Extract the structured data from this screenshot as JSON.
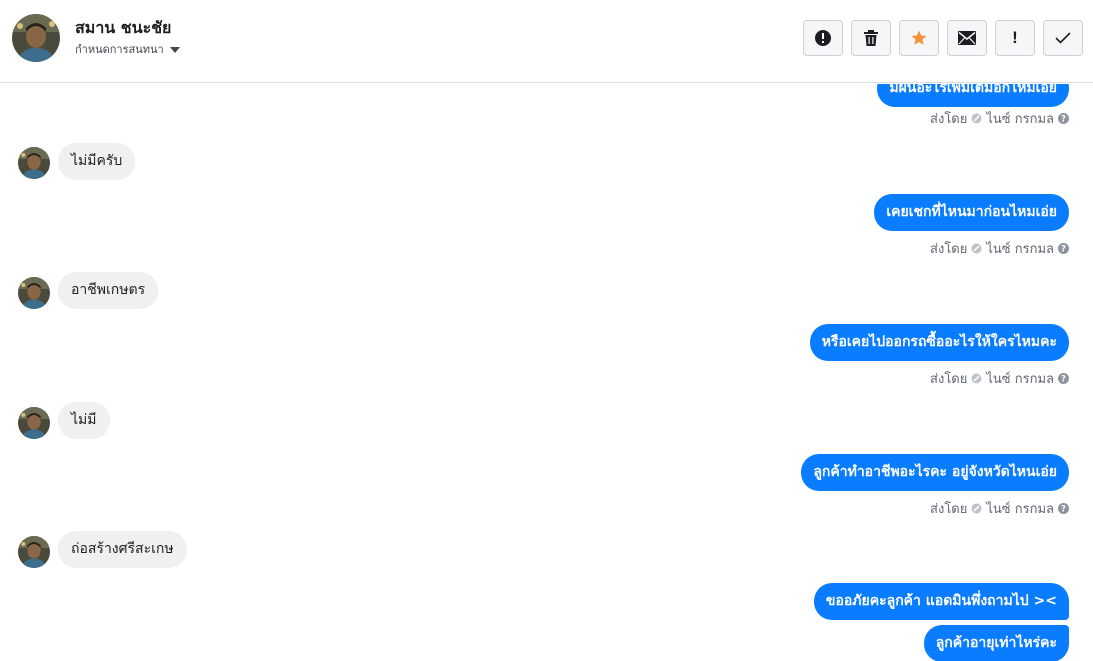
{
  "header": {
    "name": "สมาน ชนะชัย",
    "subtitle": "กำหนดการสนทนา",
    "avatar_icon": "profile-photo"
  },
  "toolbar": {
    "buttons": [
      {
        "name": "spam-button",
        "icon": "exclamation-circle-icon"
      },
      {
        "name": "delete-button",
        "icon": "trash-icon"
      },
      {
        "name": "star-button",
        "icon": "star-icon",
        "color": "#f7923b"
      },
      {
        "name": "mail-button",
        "icon": "envelope-icon"
      },
      {
        "name": "important-button",
        "label": "!"
      },
      {
        "name": "done-button",
        "icon": "checkmark-icon"
      }
    ]
  },
  "thread": {
    "messages": [
      {
        "dir": "out",
        "text": "มีผีนอะไรเพิ่มเติมอีกไหมเอ่ย",
        "meta": {
          "sent_by": "ส่งโดย",
          "agent": "ไนซ์ กรกมล"
        }
      },
      {
        "dir": "in",
        "text": "ไม่มีครับ"
      },
      {
        "dir": "out",
        "text": "เคยเชกที่ไหนมาก่อนไหมเอ่ย",
        "meta": {
          "sent_by": "ส่งโดย",
          "agent": "ไนซ์ กรกมล"
        }
      },
      {
        "dir": "in",
        "text": "อาชีพเกษตร"
      },
      {
        "dir": "out",
        "text": "หรือเคยไปออกรถซื้ออะไรให้ใครไหมคะ",
        "meta": {
          "sent_by": "ส่งโดย",
          "agent": "ไนซ์ กรกมล"
        }
      },
      {
        "dir": "in",
        "text": "ไม่มี"
      },
      {
        "dir": "out",
        "text": "ลูกค้าทำอาชีพอะไรคะ อยู่จังหวัดไหนเอ่ย",
        "meta": {
          "sent_by": "ส่งโดย",
          "agent": "ไนซ์ กรกมล"
        }
      },
      {
        "dir": "in",
        "text": "ถ่อสร้างศรีสะเกษ"
      },
      {
        "dir": "out",
        "text": "ขออภัยคะลูกค้า แอดมินพึ่งถามไป ><"
      },
      {
        "dir": "out",
        "text": "ลูกค้าอายุเท่าไหร่คะ"
      }
    ]
  },
  "colors": {
    "outgoing_bubble": "#0a7cff",
    "incoming_bubble": "#f0f0f0",
    "star": "#f7923b"
  }
}
